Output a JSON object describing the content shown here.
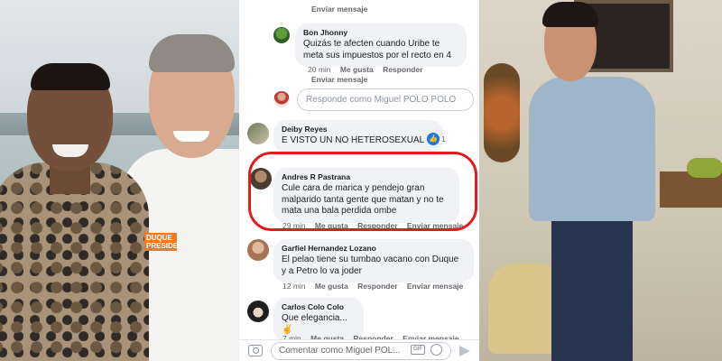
{
  "left_photo": {
    "badge_line1": "DUQUE",
    "badge_line2": "PRESIDENTE"
  },
  "comments": [
    {
      "action": "Enviar mensaje"
    },
    {
      "author": "Bon Jhonny",
      "text": "Quizás te afecten cuando Uribe te meta sus impuestos por el recto en 4",
      "time": "20 min",
      "like": "Me gusta",
      "reply": "Responder",
      "message": "Enviar mensaje"
    },
    {
      "author": "Deiby Reyes",
      "text": "E VISTO UN NO HETEROSEXUAL",
      "reactions": "1"
    },
    {
      "author": "Andres R Pastrana",
      "text": "Cule cara de marica y pendejo gran malparido tanta gente que matan y no te mata una bala perdida ombe",
      "time": "29 min",
      "like": "Me gusta",
      "reply": "Responder",
      "message": "Enviar mensaje"
    },
    {
      "author": "Garfiel Hernandez Lozano",
      "text": "El pelao tiene su tumbao vacano con Duque y a Petro lo va joder",
      "time": "12 min",
      "like": "Me gusta",
      "reply": "Responder",
      "message": "Enviar mensaje"
    },
    {
      "author": "Carlos Colo Colo",
      "text": "Que elegancia...✌",
      "time": "7 min",
      "like": "Me gusta",
      "reply": "Responder",
      "message": "Enviar mensaje"
    }
  ],
  "reply_box": {
    "placeholder": "Responde como Miguel POLO POLO"
  },
  "comment_bar": {
    "placeholder": "Comentar como Miguel POL...",
    "gif": "GIF"
  }
}
